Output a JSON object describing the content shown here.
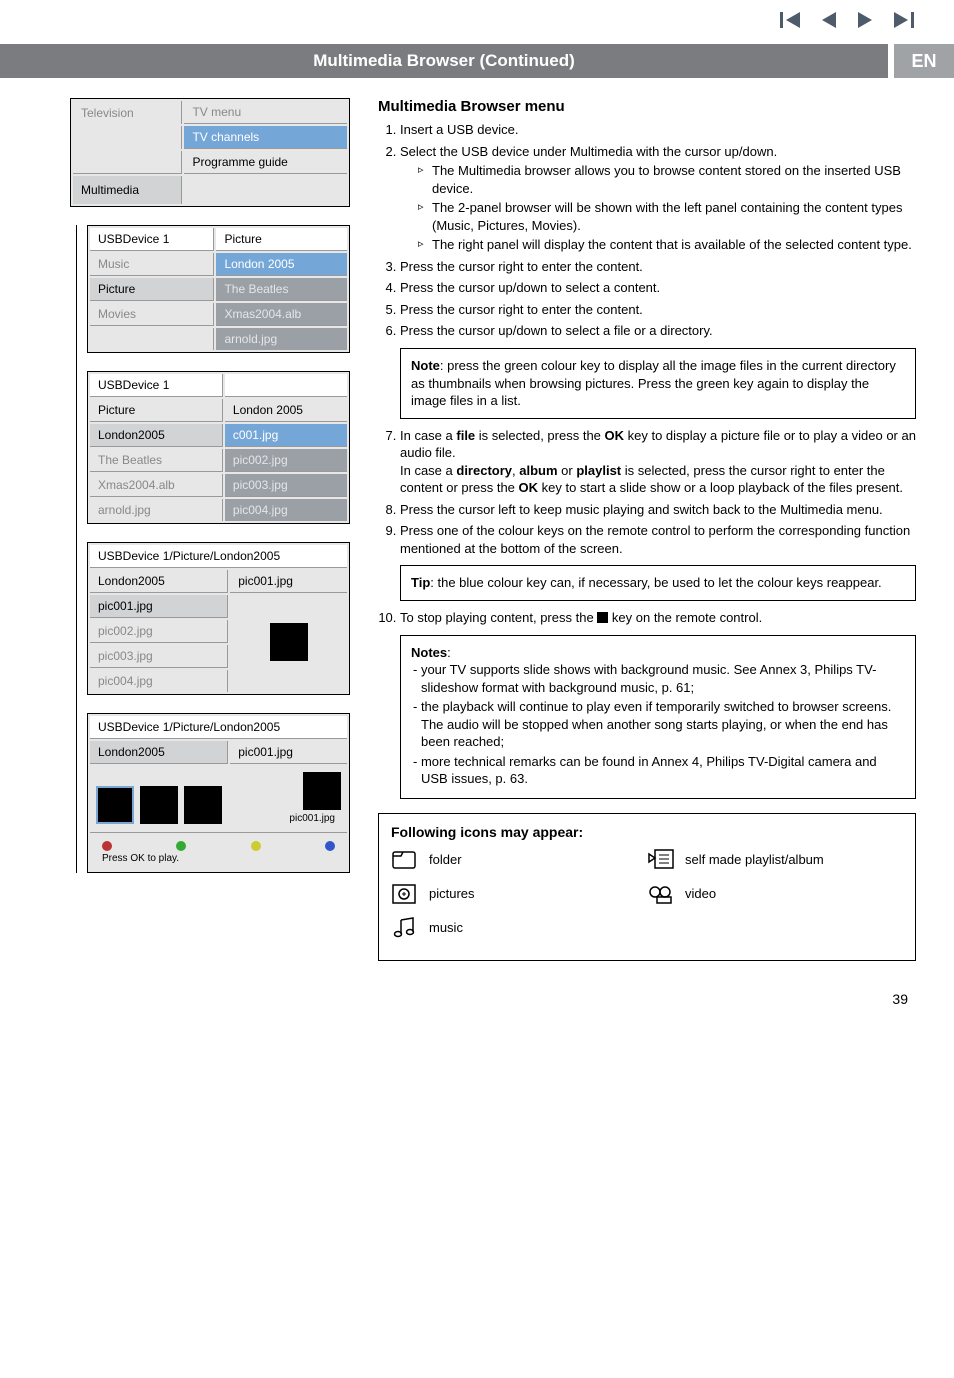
{
  "nav_icons": [
    "skip-prev-icon",
    "play-prev-icon",
    "play-next-icon",
    "skip-next-icon"
  ],
  "titlebar": {
    "main": "Multimedia Browser  (Continued)",
    "lang": "EN"
  },
  "panel1": {
    "c1r1": "Television",
    "c2r1": "TV menu",
    "c2r2": "TV channels",
    "c2r3": "Programme guide",
    "c1r4": "Multimedia"
  },
  "panel2": {
    "h1": "USBDevice 1",
    "h2": "Picture",
    "rows": [
      [
        "Music",
        "London 2005"
      ],
      [
        "Picture",
        "The Beatles"
      ],
      [
        "Movies",
        "Xmas2004.alb"
      ],
      [
        "",
        "arnold.jpg"
      ]
    ]
  },
  "panel3": {
    "h1": "USBDevice 1",
    "h2": "",
    "rows": [
      [
        "Picture",
        "London 2005"
      ],
      [
        "London2005",
        "c001.jpg"
      ],
      [
        "The Beatles",
        "pic002.jpg"
      ],
      [
        "Xmas2004.alb",
        "pic003.jpg"
      ],
      [
        "arnold.jpg",
        "pic004.jpg"
      ]
    ]
  },
  "panel4": {
    "bc": "USBDevice 1/Picture/London2005",
    "rows": [
      [
        "London2005",
        "pic001.jpg"
      ],
      [
        "pic001.jpg",
        ""
      ],
      [
        "pic002.jpg",
        ""
      ],
      [
        "pic003.jpg",
        ""
      ],
      [
        "pic004.jpg",
        ""
      ]
    ]
  },
  "panel5": {
    "bc": "USBDevice 1/Picture/London2005",
    "row": [
      "London2005",
      "pic001.jpg"
    ],
    "cap": "pic001.jpg",
    "hint": "Press OK to play."
  },
  "content": {
    "heading": "Multimedia Browser menu",
    "s1": "Insert a USB device.",
    "s2": "Select the USB device under Multimedia with the cursor up/down.",
    "s2a": "The Multimedia browser allows you to browse content stored on the inserted USB device.",
    "s2b": "The 2-panel browser will be shown with the left panel containing the content types (Music, Pictures, Movies).",
    "s2c": "The right panel will display the content that is available of the selected content type.",
    "s3": "Press the cursor right to enter the content.",
    "s4": "Press the cursor up/down to select a content.",
    "s5": "Press the cursor right to enter the content.",
    "s6": "Press the cursor up/down to select a file or a directory.",
    "note1_label": "Note",
    "note1": ": press the green colour key to display all the image files in the current directory as thumbnails when browsing pictures. Press the green key again to display the image files in a list.",
    "s7a": "In case a ",
    "s7b": "file",
    "s7c": " is selected, press the ",
    "s7d": "OK",
    "s7e": " key to display a picture file or to play a video or an audio file.",
    "s7f": "In case a ",
    "s7g": "directory",
    "s7h": ", ",
    "s7i": "album",
    "s7j": " or ",
    "s7k": "playlist",
    "s7l": " is selected, press the cursor right to enter the content or press the ",
    "s7m": "OK",
    "s7n": " key to start a slide show or a loop playback of the files present.",
    "s8": "Press the cursor left to keep music playing and switch back to the Multimedia menu.",
    "s9": "Press one of the colour keys on the remote control to perform the corresponding function mentioned at the bottom of the screen.",
    "tip_label": "Tip",
    "tip": ": the blue colour key can, if necessary, be used to let the colour keys reappear.",
    "s10a": "To stop playing content, press the ",
    "s10b": " key on the remote control.",
    "notes_label": "Notes",
    "n1": "- your TV supports slide shows with background music. See Annex 3, Philips TV-slideshow format with background music, p. 61;",
    "n2": "- the playback will continue to play even if temporarily switched to browser screens. The audio will be stopped when another song starts playing, or when the end has been reached;",
    "n3": "- more technical remarks can be found in Annex 4, Philips TV-Digital camera and USB issues, p. 63."
  },
  "icons": {
    "heading": "Following icons may appear:",
    "folder": "folder",
    "pictures": "pictures",
    "music": "music",
    "playlist": "self made playlist/album",
    "video": "video"
  },
  "pagenum": "39"
}
